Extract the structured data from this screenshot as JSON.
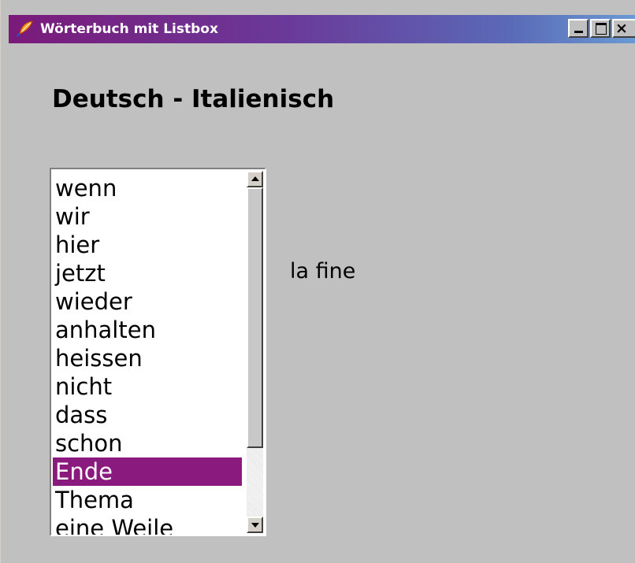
{
  "window": {
    "title": "Wörterbuch mit Listbox",
    "icon": "feather-icon",
    "controls": {
      "minimize": "minimize-icon",
      "maximize": "maximize-icon",
      "close_label": "×"
    }
  },
  "heading": "Deutsch - Italienisch",
  "listbox": {
    "items": [
      "wenn",
      "wir",
      "hier",
      "jetzt",
      "wieder",
      "anhalten",
      "heissen",
      "nicht",
      "dass",
      "schon",
      "Ende",
      "Thema",
      "eine Weile"
    ],
    "selected_index": 10,
    "selected_color": "#8b1a7e"
  },
  "translation": "la fine"
}
